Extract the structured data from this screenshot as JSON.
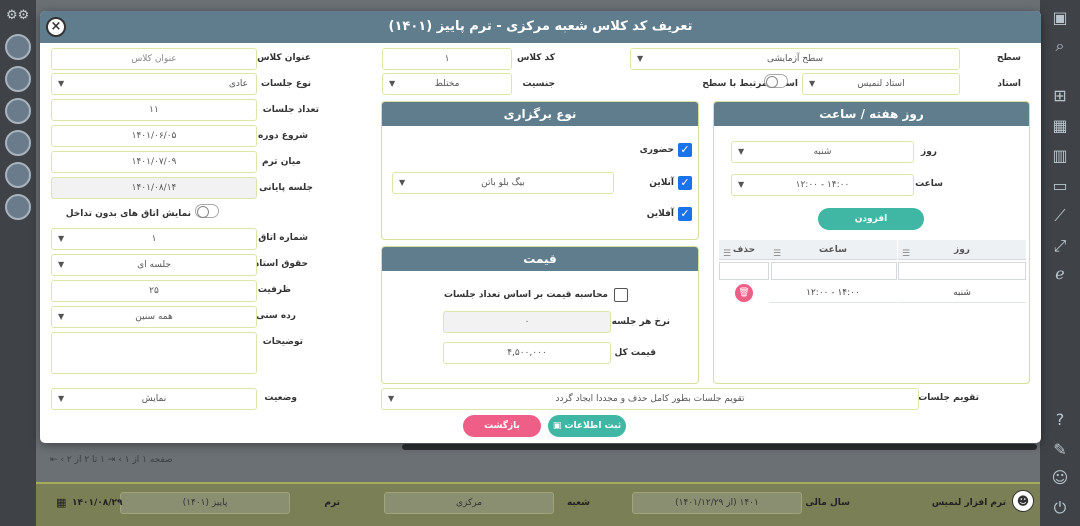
{
  "modal": {
    "title": "تعریف کد کلاس شعبه مرکزی - ترم پاییز (۱۴۰۱)"
  },
  "form": {
    "level": {
      "label": "سطح",
      "value": "سطح آزمایشی"
    },
    "class_code": {
      "label": "کد کلاس",
      "value": "۱"
    },
    "class_title": {
      "label": "عنوان کلاس",
      "placeholder": "عنوان کلاس"
    },
    "teacher": {
      "label": "استاد",
      "value": "استاد لنمیس"
    },
    "related_teachers": {
      "label": "اساتید مرتبط با سطح"
    },
    "gender": {
      "label": "جنسیت",
      "value": "مختلط"
    },
    "session_type": {
      "label": "نوع جلسات",
      "value": "عادی"
    },
    "session_count": {
      "label": "تعداد جلسات",
      "value": "۱۱"
    },
    "course_start": {
      "label": "شروع دوره",
      "value": "۱۴۰۱/۰۶/۰۵"
    },
    "mid_term": {
      "label": "میان ترم",
      "value": "۱۴۰۱/۰۷/۰۹"
    },
    "final_session": {
      "label": "جلسه پایانی",
      "value": "۱۴۰۱/۰۸/۱۴"
    },
    "show_rooms": {
      "label": "نمایش اتاق های بدون تداخل"
    },
    "room_number": {
      "label": "شماره اتاق",
      "value": "۱"
    },
    "teacher_pay": {
      "label": "حقوق استاد",
      "value": "جلسه ای"
    },
    "capacity": {
      "label": "ظرفیت",
      "value": "۲۵"
    },
    "age_group": {
      "label": "رده سنی",
      "value": "همه سنین"
    },
    "description": {
      "label": "توضیحات"
    },
    "status": {
      "label": "وضعیت",
      "value": "نمایش"
    },
    "calendar": {
      "label": "تقویم جلسات",
      "value": "تقویم جلسات بطور کامل حذف و مجددا ایجاد گردد"
    }
  },
  "delivery": {
    "title": "نوع برگزاری",
    "in_person": "حضوری",
    "online": "آنلاین",
    "offline": "آفلاین",
    "platform": "بیگ بلو باتن"
  },
  "price": {
    "title": "قیمت",
    "by_sessions": "محاسبه قیمت بر اساس تعداد جلسات",
    "per_session_label": "نرخ هر جلسه",
    "per_session_value": "۰",
    "total_label": "قیمت کل",
    "total_value": "۴,۵۰۰,۰۰۰"
  },
  "schedule": {
    "title": "روز هفته / ساعت",
    "day_label": "روز",
    "day_value": "شنبه",
    "time_label": "ساعت",
    "time_value": "۱۲:۰۰ - ۱۴:۰۰",
    "add_label": "افزودن",
    "columns": [
      "روز",
      "ساعت",
      "حذف"
    ],
    "rows": [
      {
        "day": "شنبه",
        "time": "۱۲:۰۰ - ۱۴:۰۰"
      }
    ]
  },
  "actions": {
    "save": "ثبت اطلاعات",
    "back": "بازگشت"
  },
  "background": {
    "pager_text": "۱ تا ۲ از ۲",
    "pager_page": "صفحه ۱ از ۱",
    "user_name": "ترم افزار لنمیس",
    "year_label": "سال مالی",
    "year_value": "(از ۱۴۰۱/۱۲/۲۹) ۱۴۰۱",
    "branch_label": "شعبه",
    "branch_value": "مرکزی",
    "term_label": "ترم",
    "term_value": "پاییز (۱۴۰۱)",
    "date": "۱۴۰۱/۰۸/۲۹"
  }
}
